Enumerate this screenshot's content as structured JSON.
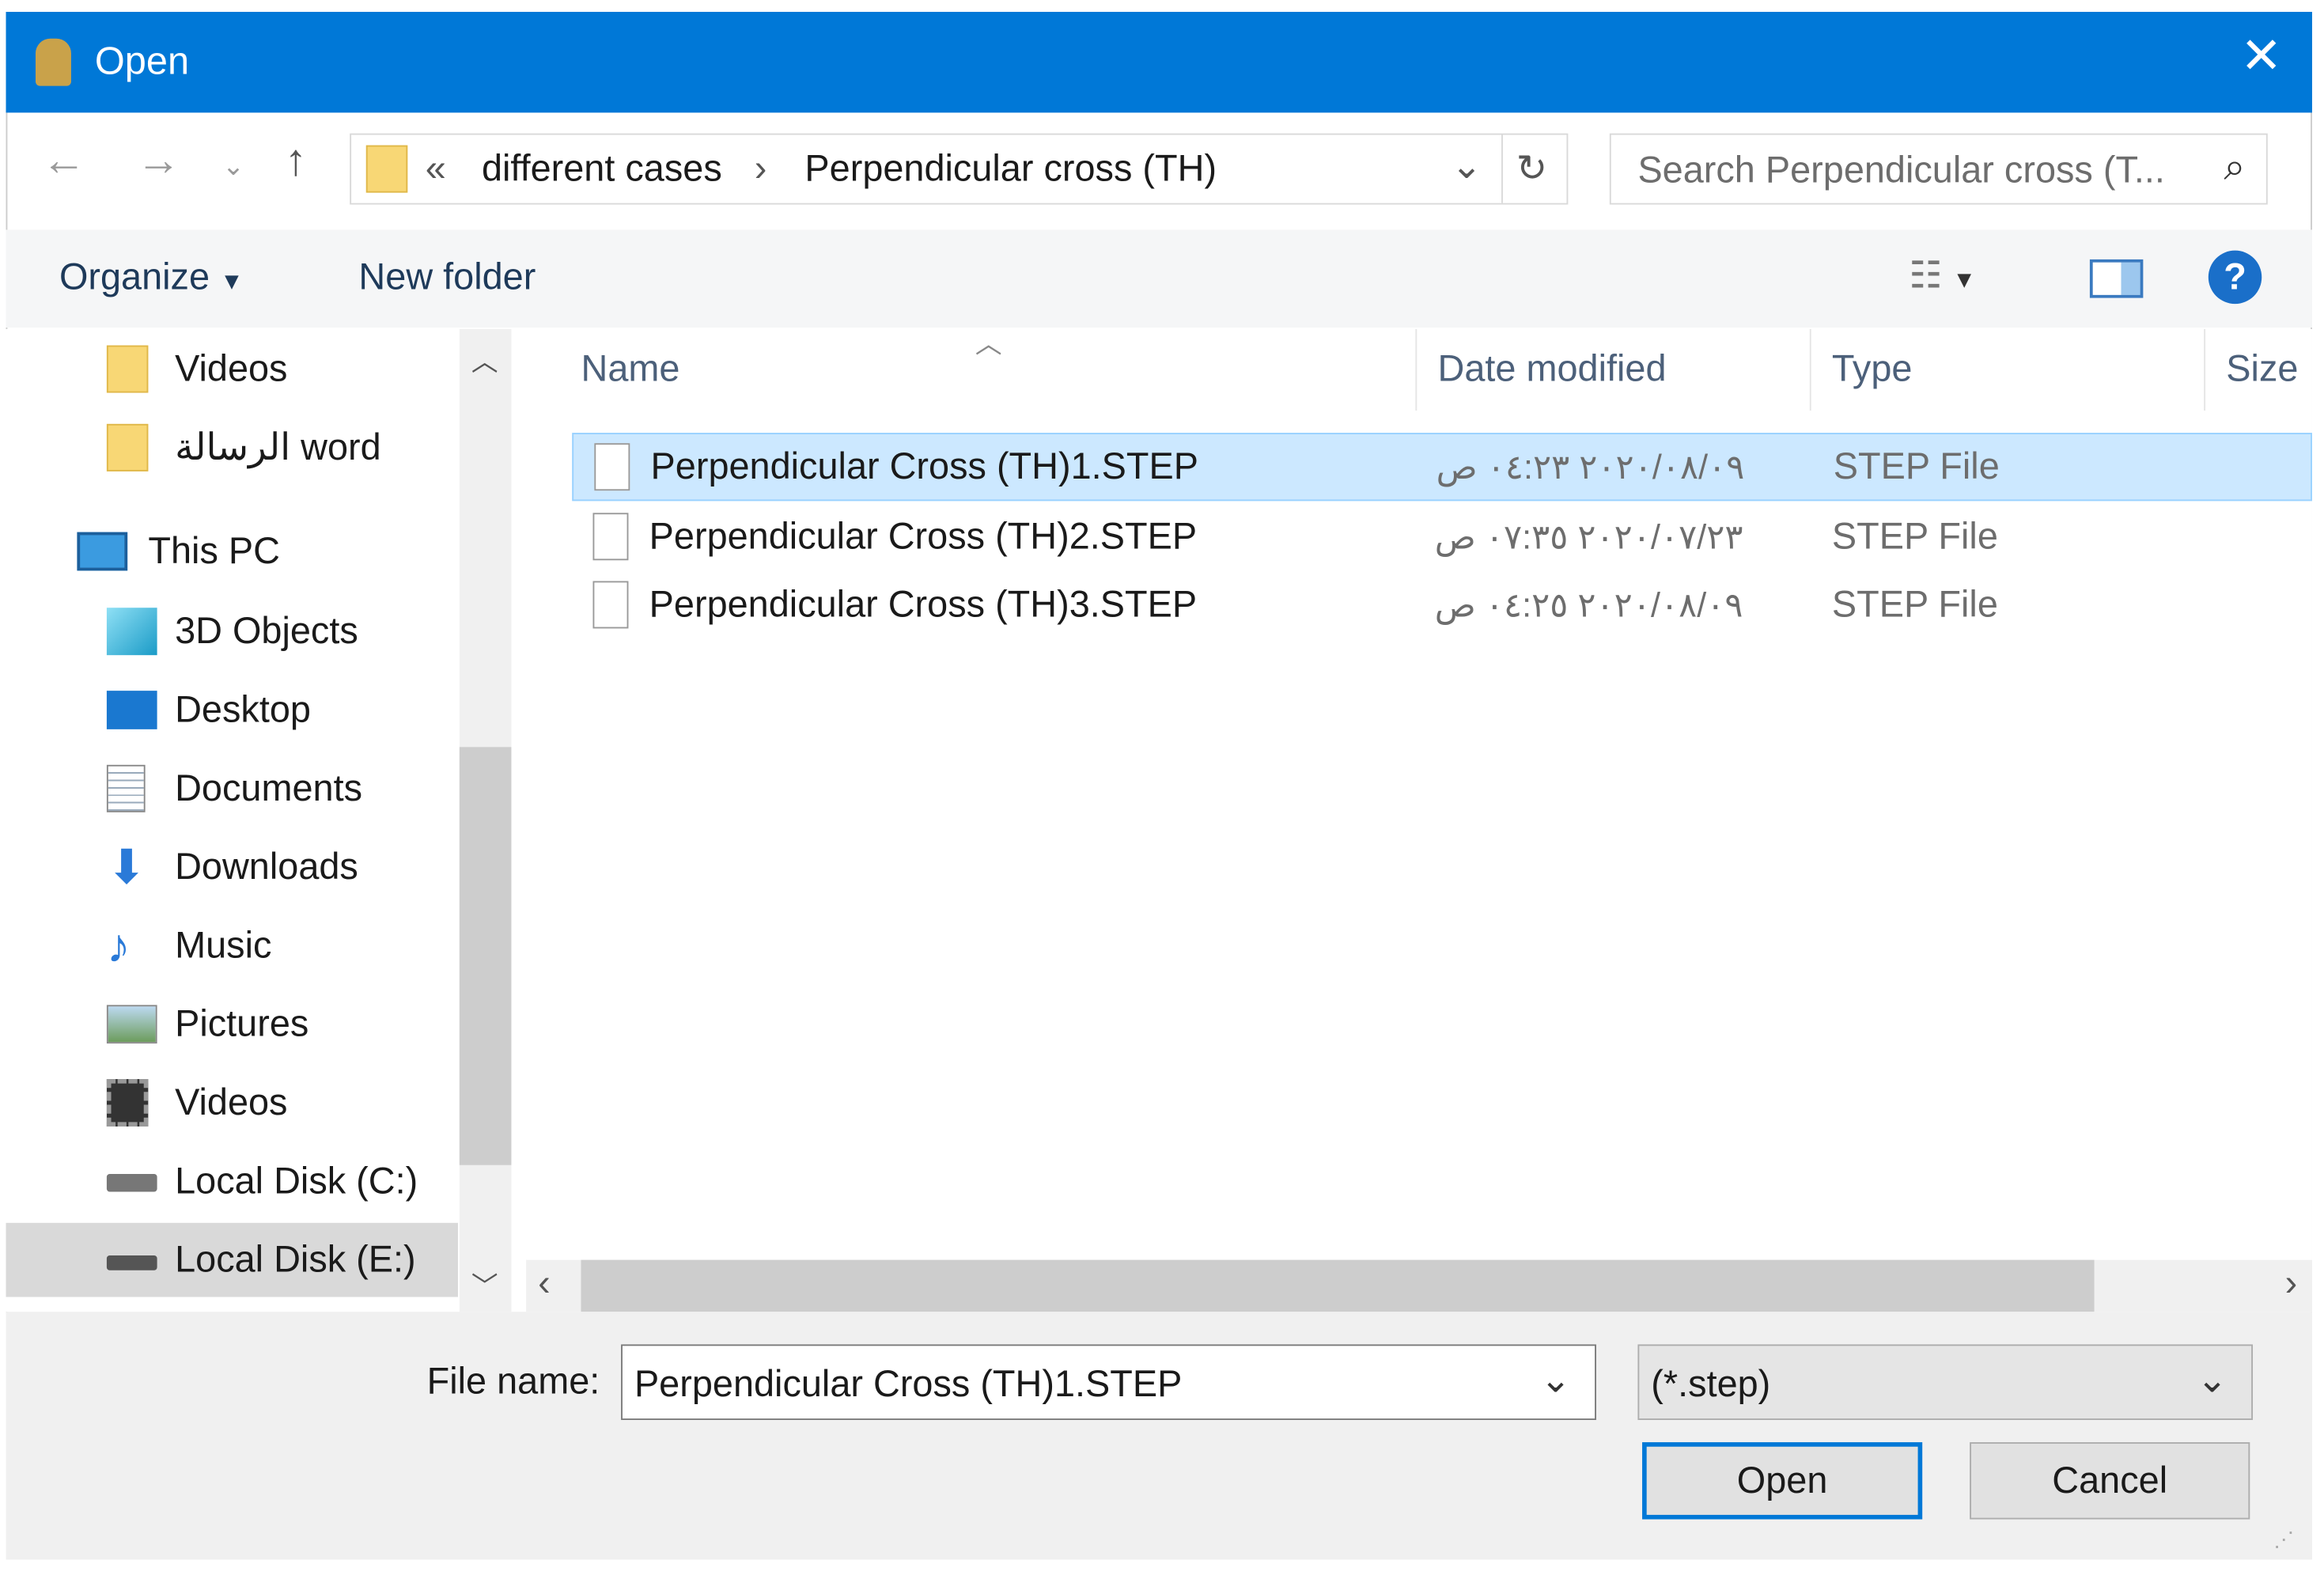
{
  "title": "Open",
  "address": {
    "prefix": "«",
    "crumbs": [
      "different cases",
      "Perpendicular cross (TH)"
    ]
  },
  "search": {
    "placeholder": "Search Perpendicular cross (T..."
  },
  "toolbar": {
    "organize": "Organize",
    "new_folder": "New folder"
  },
  "nav_items": [
    {
      "label": "Videos",
      "icon": "folder-icon"
    },
    {
      "label": "الرسالة word",
      "icon": "folder-icon"
    },
    {
      "label": "This PC",
      "icon": "computer-icon"
    },
    {
      "label": "3D Objects",
      "icon": "cube-icon"
    },
    {
      "label": "Desktop",
      "icon": "desktop-icon"
    },
    {
      "label": "Documents",
      "icon": "document-icon"
    },
    {
      "label": "Downloads",
      "icon": "download-icon"
    },
    {
      "label": "Music",
      "icon": "music-icon"
    },
    {
      "label": "Pictures",
      "icon": "picture-icon"
    },
    {
      "label": "Videos",
      "icon": "film-icon"
    },
    {
      "label": "Local Disk (C:)",
      "icon": "drive-icon"
    },
    {
      "label": "Local Disk (E:)",
      "icon": "drive-icon"
    }
  ],
  "columns": [
    "Name",
    "Date modified",
    "Type",
    "Size"
  ],
  "files": [
    {
      "name": "Perpendicular Cross (TH)1.STEP",
      "date": "٢٠٢٠/٠٨/٠٩ ٠٤:٢٣ ص",
      "type": "STEP File"
    },
    {
      "name": "Perpendicular Cross (TH)2.STEP",
      "date": "٢٠٢٠/٠٧/٢٣ ٠٧:٣٥ ص",
      "type": "STEP File"
    },
    {
      "name": "Perpendicular Cross (TH)3.STEP",
      "date": "٢٠٢٠/٠٨/٠٩ ٠٤:٢٥ ص",
      "type": "STEP File"
    }
  ],
  "bottom": {
    "file_name_label": "File name:",
    "file_name_value": "Perpendicular Cross (TH)1.STEP",
    "filter": "(*.step)",
    "open": "Open",
    "cancel": "Cancel"
  },
  "colors": {
    "accent": "#0078d7",
    "selection": "#cce8ff"
  }
}
